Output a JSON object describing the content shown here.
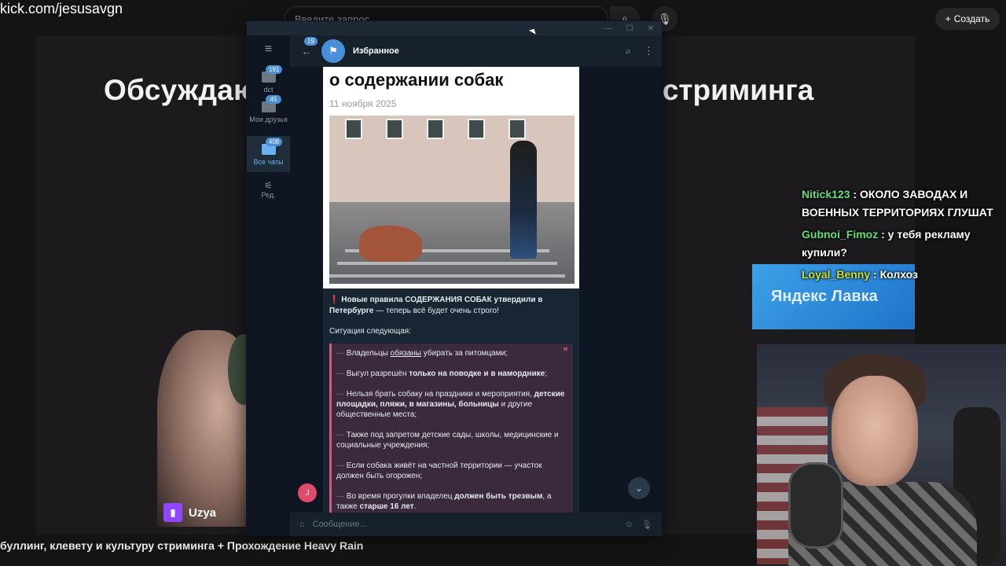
{
  "browser": {
    "url": "kick.com/jesusavgn",
    "search_placeholder": "Введите запрос",
    "search_icon": "search-icon",
    "mic_icon": "mic-icon",
    "create_label": "Создать"
  },
  "video": {
    "title_left": "Обсуждаю",
    "title_right": "у стриминга",
    "caption": "буллинг, клевету и культуру стриминга + Прохождение Heavy Rain",
    "streamer_tag": "Uzya"
  },
  "yandex_card": {
    "text": "Яндекс Лавка"
  },
  "chat": [
    {
      "user": "Nitick123",
      "text": "ОКОЛО ЗАВОДАХ И ВОЕННЫХ ТЕРРИТОРИЯХ ГЛУШАТ",
      "color": "#5fe07a"
    },
    {
      "user": "Gubnoi_Fimoz",
      "text": "у тебя рекламу купили?",
      "color": "#5fe07a"
    },
    {
      "user": "Loyal_Benny",
      "text": "Колхоз",
      "color": "#c8e040"
    }
  ],
  "telegram": {
    "folders": [
      {
        "label": "dct",
        "badge": "191"
      },
      {
        "label": "Мои друзья",
        "badge": "45"
      },
      {
        "label": "Все чаты",
        "badge": "408",
        "active": true
      },
      {
        "label": "Ред.",
        "badge": ""
      }
    ],
    "back_badge": "19",
    "chat_name": "Избранное",
    "post": {
      "headline": "о содержании собак",
      "date": "11 ноября 2025",
      "intro_bold": "Новые правила СОДЕРЖАНИЯ СОБАК утвердили в",
      "intro_bold2": "Петербурге",
      "intro_rest": "— теперь всё будет очень строго!",
      "situation": "Ситуация следующая:",
      "rules": [
        {
          "pre": "Владельцы ",
          "underline": "обязаны",
          "post": " убирать за питомцами;"
        },
        {
          "pre": "Выгул разрешён ",
          "bold": "только на поводке и в наморднике",
          "post": ";"
        },
        {
          "pre": "Нельзя брать собаку на праздники и мероприятия, ",
          "bold": "детские площадки, пляжи, в магазины, больницы",
          "post": " и другие общественные места;"
        },
        {
          "pre": "Также под запретом детские сады, школы, медицинские и социальные учреждения;",
          "bold": "",
          "post": ""
        },
        {
          "pre": "Если собака живёт на частной территории — участок должен быть огорожен;",
          "bold": "",
          "post": ""
        },
        {
          "pre": "Во время прогулки владелец ",
          "bold": "должен быть трезвым",
          "post": ", а также ",
          "bold2": "старше 16 лет",
          "post2": "."
        }
      ]
    },
    "user_initial": "J",
    "input_placeholder": "Сообщение..."
  }
}
